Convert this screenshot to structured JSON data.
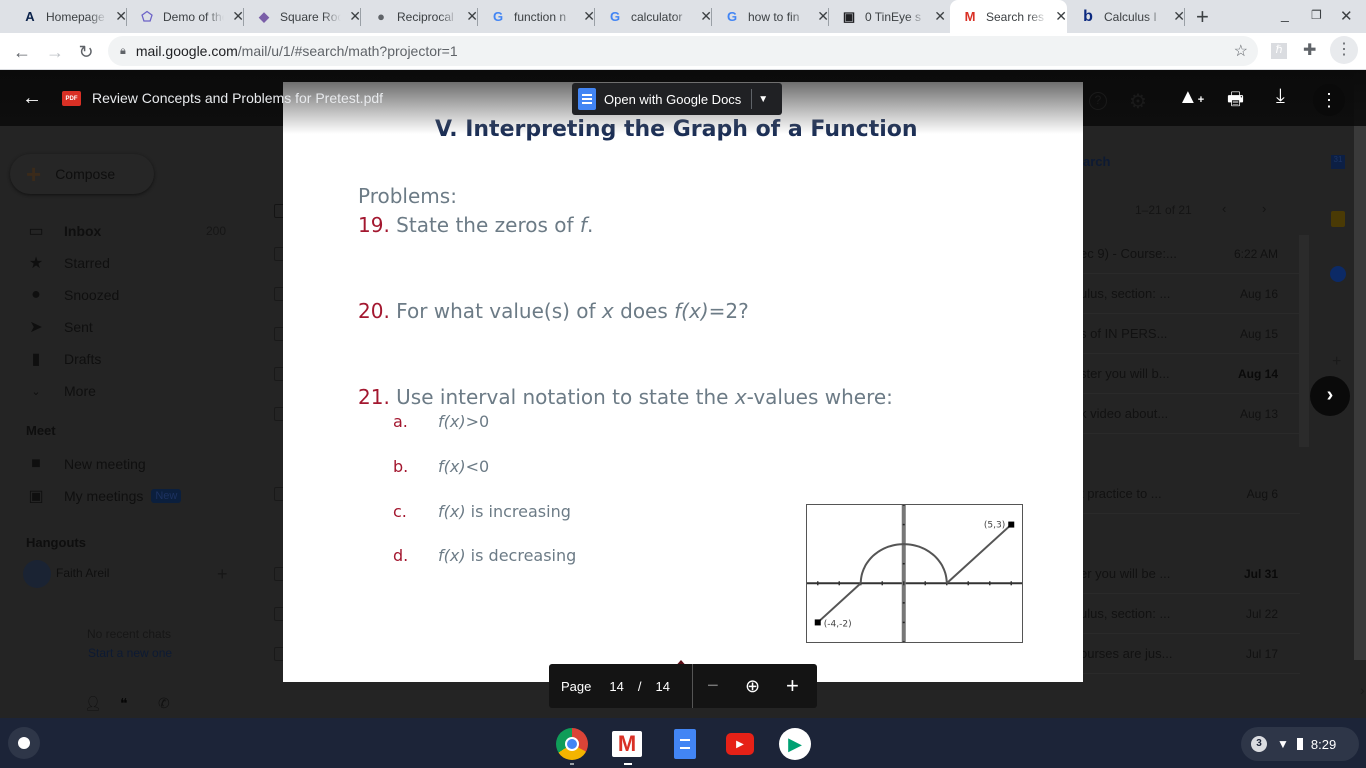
{
  "browser": {
    "tabs": [
      {
        "label": "Homepage",
        "icon": "university-arizona-icon",
        "active": false
      },
      {
        "label": "Demo of the",
        "icon": "geogebra-icon",
        "active": false
      },
      {
        "label": "Square Root",
        "icon": "square-root-icon",
        "active": false
      },
      {
        "label": "Reciprocal",
        "icon": "globe-icon",
        "active": false
      },
      {
        "label": "function n",
        "icon": "google-icon",
        "active": false
      },
      {
        "label": "calculator",
        "icon": "google-icon",
        "active": false
      },
      {
        "label": "how to fin",
        "icon": "google-icon",
        "active": false
      },
      {
        "label": "0 TinEye s",
        "icon": "film-icon",
        "active": false
      },
      {
        "label": "Search res",
        "icon": "gmail-icon",
        "active": true
      },
      {
        "label": "Calculus I",
        "icon": "bing-icon",
        "active": false
      }
    ],
    "new_tab": "+",
    "url_host": "mail.google.com",
    "url_path": "/mail/u/1/#search/math?projector=1"
  },
  "viewer": {
    "file_name": "Review Concepts and Problems for Pretest.pdf",
    "file_badge": "PDF",
    "open_with": "Open with Google Docs",
    "pager": {
      "label": "Page",
      "current": "14",
      "sep": "/",
      "total": "14"
    }
  },
  "document": {
    "heading": "V.  Interpreting the Graph of a Function",
    "problems_label": "Problems:",
    "problems": [
      {
        "num": "19.",
        "text_before": " State the zeros of ",
        "var": "f",
        "text_after": "."
      },
      {
        "num": "20.",
        "text": " For what value(s) of ",
        "x": "x",
        "mid": " does ",
        "fx": "f(x)",
        "after": "=2?"
      },
      {
        "num": "21.",
        "text": " Use interval notation to state the ",
        "x": "x",
        "after": "-values where:"
      }
    ],
    "subparts": [
      {
        "letter": "a.",
        "fx": "f(x)",
        "text": ">0"
      },
      {
        "letter": "b.",
        "fx": "f(x)",
        "text": "<0"
      },
      {
        "letter": "c.",
        "fx": "f(x)",
        "text": " is increasing"
      },
      {
        "letter": "d.",
        "fx": "f(x)",
        "text": " is decreasing"
      }
    ],
    "graph": {
      "endpoint_right_label": "(5,3)",
      "endpoint_left_label": "(-4,-2)",
      "segments": [
        {
          "type": "line",
          "from": [
            -4,
            -2
          ],
          "to": [
            -2,
            0
          ]
        },
        {
          "type": "semicircle",
          "center": [
            0,
            0
          ],
          "radius": 2
        },
        {
          "type": "line",
          "from": [
            2,
            0
          ],
          "to": [
            5,
            3
          ]
        }
      ],
      "xlim": [
        -4.5,
        5.5
      ],
      "ylim": [
        -3,
        4
      ]
    }
  },
  "gmail": {
    "compose": "Compose",
    "nav": [
      {
        "label": "Inbox",
        "count": "200",
        "icon": "inbox-icon"
      },
      {
        "label": "Starred",
        "icon": "star-icon"
      },
      {
        "label": "Snoozed",
        "icon": "clock-icon"
      },
      {
        "label": "Sent",
        "icon": "send-icon"
      },
      {
        "label": "Drafts",
        "icon": "draft-icon"
      },
      {
        "label": "More",
        "icon": "chevron-down-icon"
      }
    ],
    "meet_title": "Meet",
    "meet": [
      {
        "label": "New meeting",
        "icon": "video-icon"
      },
      {
        "label": "My meetings",
        "badge": "New",
        "icon": "calendar-icon"
      }
    ],
    "hangouts_title": "Hangouts",
    "user": "Faith Areil",
    "no_chats": "No recent chats",
    "start_new": "Start a new one",
    "search_partial": "arch",
    "pagination": "1–21 of 21",
    "rows": [
      {
        "snippet": "ec 9) - Course:...",
        "date": "6:22 AM",
        "bold": false
      },
      {
        "snippet": "ulus, section: ...",
        "date": "Aug 16",
        "bold": false
      },
      {
        "snippet": "s of IN PERS...",
        "date": "Aug 15",
        "bold": false
      },
      {
        "snippet": "ster you will b...",
        "date": "Aug 14",
        "bold": true
      },
      {
        "snippet": "k video about...",
        "date": "Aug 13",
        "bold": false
      },
      {
        "snippet": "t practice to ...",
        "date": "Aug 6",
        "bold": false
      },
      {
        "snippet": "er you will be ...",
        "date": "Jul 31",
        "bold": true
      },
      {
        "snippet": "ulus, section: ...",
        "date": "Jul 22",
        "bold": false
      },
      {
        "snippet": "ourses are jus...",
        "date": "Jul 17",
        "bold": false
      }
    ]
  },
  "shelf": {
    "apps": [
      "chrome-icon",
      "gmail-icon",
      "docs-icon",
      "youtube-icon",
      "play-store-icon"
    ],
    "notifications": "3",
    "time": "8:29"
  }
}
